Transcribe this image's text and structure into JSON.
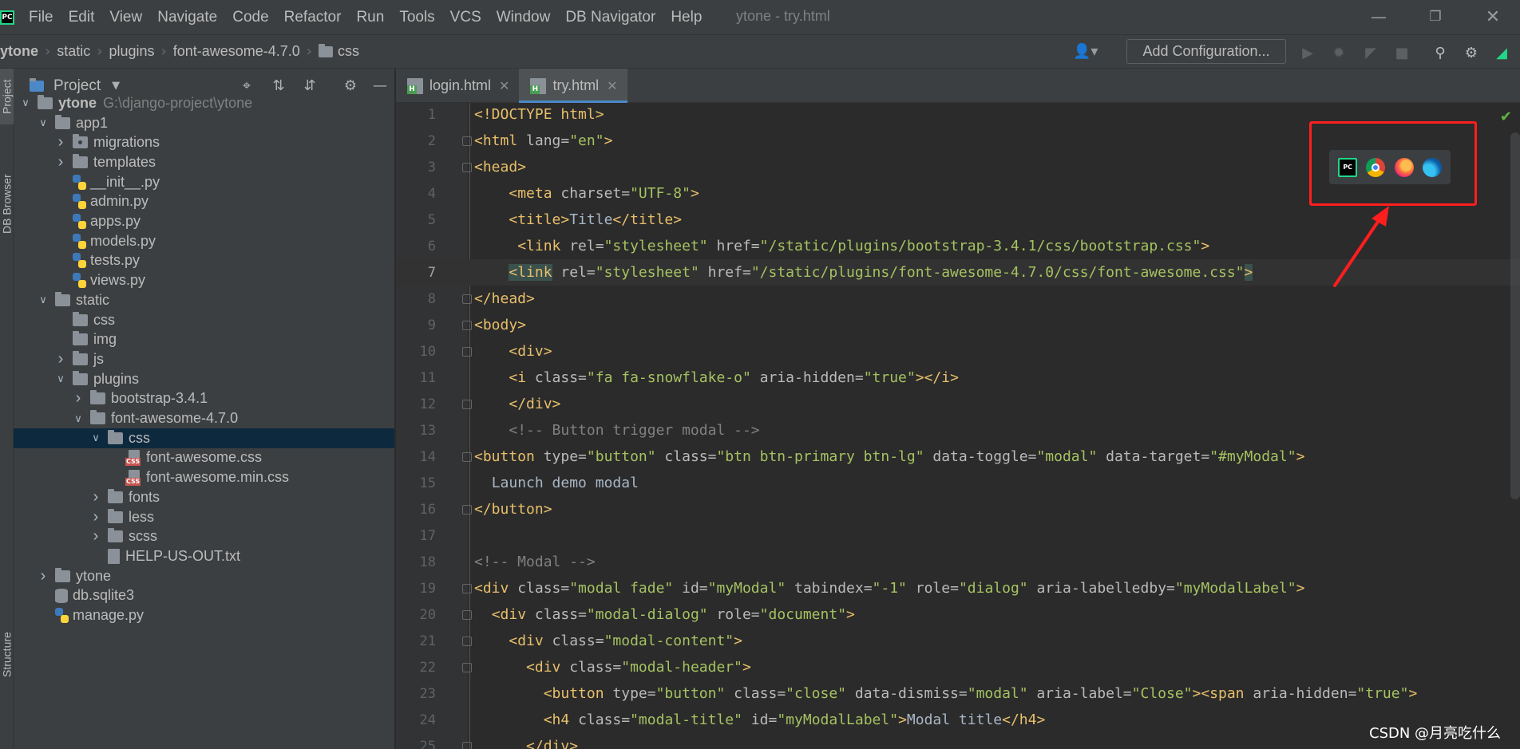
{
  "menubar": {
    "items": [
      "File",
      "Edit",
      "View",
      "Navigate",
      "Code",
      "Refactor",
      "Run",
      "Tools",
      "VCS",
      "Window",
      "DB Navigator",
      "Help"
    ],
    "window_title": "ytone - try.html"
  },
  "breadcrumb": [
    "ytone",
    "static",
    "plugins",
    "font-awesome-4.7.0",
    "css"
  ],
  "toolbar": {
    "add_configuration": "Add Configuration..."
  },
  "left_strip": {
    "project_tab": "Project",
    "db_browser_tab": "DB Browser",
    "structure_tab": "Structure"
  },
  "project_panel": {
    "title": "Project",
    "root_path": "G:\\django-project\\ytone",
    "tree": [
      {
        "label": "ytone",
        "type": "folder",
        "depth": 0,
        "expanded": true
      },
      {
        "label": "app1",
        "type": "folder",
        "depth": 1,
        "expanded": true
      },
      {
        "label": "migrations",
        "type": "package",
        "depth": 2,
        "expanded": false
      },
      {
        "label": "templates",
        "type": "folder",
        "depth": 2,
        "expanded": false
      },
      {
        "label": "__init__.py",
        "type": "py",
        "depth": 2
      },
      {
        "label": "admin.py",
        "type": "py",
        "depth": 2
      },
      {
        "label": "apps.py",
        "type": "py",
        "depth": 2
      },
      {
        "label": "models.py",
        "type": "py",
        "depth": 2
      },
      {
        "label": "tests.py",
        "type": "py",
        "depth": 2
      },
      {
        "label": "views.py",
        "type": "py",
        "depth": 2
      },
      {
        "label": "static",
        "type": "folder",
        "depth": 1,
        "expanded": true
      },
      {
        "label": "css",
        "type": "folder",
        "depth": 2
      },
      {
        "label": "img",
        "type": "folder",
        "depth": 2
      },
      {
        "label": "js",
        "type": "folder",
        "depth": 2,
        "expanded": false
      },
      {
        "label": "plugins",
        "type": "folder",
        "depth": 2,
        "expanded": true
      },
      {
        "label": "bootstrap-3.4.1",
        "type": "folder",
        "depth": 3,
        "expanded": false
      },
      {
        "label": "font-awesome-4.7.0",
        "type": "folder",
        "depth": 3,
        "expanded": true
      },
      {
        "label": "css",
        "type": "folder",
        "depth": 4,
        "expanded": true,
        "selected": true
      },
      {
        "label": "font-awesome.css",
        "type": "css",
        "depth": 5
      },
      {
        "label": "font-awesome.min.css",
        "type": "css",
        "depth": 5
      },
      {
        "label": "fonts",
        "type": "folder",
        "depth": 4,
        "expanded": false
      },
      {
        "label": "less",
        "type": "folder",
        "depth": 4,
        "expanded": false
      },
      {
        "label": "scss",
        "type": "folder",
        "depth": 4,
        "expanded": false
      },
      {
        "label": "HELP-US-OUT.txt",
        "type": "txt",
        "depth": 4
      },
      {
        "label": "ytone",
        "type": "folder",
        "depth": 1,
        "expanded": false
      },
      {
        "label": "db.sqlite3",
        "type": "db",
        "depth": 1
      },
      {
        "label": "manage.py",
        "type": "py",
        "depth": 1
      }
    ]
  },
  "editor": {
    "tabs": [
      {
        "label": "login.html",
        "active": false
      },
      {
        "label": "try.html",
        "active": true
      }
    ],
    "current_line": 7,
    "lines": [
      {
        "n": "1",
        "fold": false,
        "indent": "",
        "tokens": [
          [
            "tg",
            "<!DOCTYPE html>"
          ]
        ]
      },
      {
        "n": "2",
        "fold": true,
        "indent": "",
        "tokens": [
          [
            "tg",
            "<html "
          ],
          [
            "at",
            "lang="
          ],
          [
            "av",
            "\"en\""
          ],
          [
            "tg",
            ">"
          ]
        ]
      },
      {
        "n": "3",
        "fold": true,
        "indent": "",
        "tokens": [
          [
            "tg",
            "<head>"
          ]
        ]
      },
      {
        "n": "4",
        "fold": false,
        "indent": "    ",
        "tokens": [
          [
            "tg",
            "<meta "
          ],
          [
            "at",
            "charset="
          ],
          [
            "av",
            "\"UTF-8\""
          ],
          [
            "tg",
            ">"
          ]
        ]
      },
      {
        "n": "5",
        "fold": false,
        "indent": "    ",
        "tokens": [
          [
            "tg",
            "<title>"
          ],
          [
            "tx",
            "Title"
          ],
          [
            "tg",
            "</title>"
          ]
        ]
      },
      {
        "n": "6",
        "fold": false,
        "indent": "     ",
        "tokens": [
          [
            "tg",
            "<link "
          ],
          [
            "at",
            "rel="
          ],
          [
            "av",
            "\"stylesheet\""
          ],
          [
            "at",
            " href="
          ],
          [
            "av",
            "\"/static/plugins/bootstrap-3.4.1/css/bootstrap.css\""
          ],
          [
            "tg",
            ">"
          ]
        ]
      },
      {
        "n": "7",
        "fold": false,
        "indent": "    ",
        "tokens": [
          [
            "tg hl",
            "<link"
          ],
          [
            "at",
            " rel="
          ],
          [
            "av",
            "\"stylesheet\""
          ],
          [
            "at",
            " href="
          ],
          [
            "av",
            "\"/static/plugins/font-awesome-4.7.0/css/font-awesome.css\""
          ],
          [
            "tg hl",
            ">"
          ]
        ]
      },
      {
        "n": "8",
        "fold": true,
        "indent": "",
        "tokens": [
          [
            "tg",
            "</head>"
          ]
        ]
      },
      {
        "n": "9",
        "fold": true,
        "indent": "",
        "tokens": [
          [
            "tg",
            "<body>"
          ]
        ]
      },
      {
        "n": "10",
        "fold": true,
        "indent": "    ",
        "tokens": [
          [
            "tg",
            "<div>"
          ]
        ]
      },
      {
        "n": "11",
        "fold": false,
        "indent": "    ",
        "tokens": [
          [
            "tg",
            "<i "
          ],
          [
            "at",
            "class="
          ],
          [
            "av",
            "\"fa fa-snowflake-o\""
          ],
          [
            "at",
            " aria-hidden="
          ],
          [
            "av",
            "\"true\""
          ],
          [
            "tg",
            "></i>"
          ]
        ]
      },
      {
        "n": "12",
        "fold": true,
        "indent": "    ",
        "tokens": [
          [
            "tg",
            "</div>"
          ]
        ]
      },
      {
        "n": "13",
        "fold": false,
        "indent": "    ",
        "tokens": [
          [
            "cm",
            "<!-- Button trigger modal -->"
          ]
        ]
      },
      {
        "n": "14",
        "fold": true,
        "indent": "",
        "tokens": [
          [
            "tg",
            "<button "
          ],
          [
            "at",
            "type="
          ],
          [
            "av",
            "\"button\""
          ],
          [
            "at",
            " class="
          ],
          [
            "av",
            "\"btn btn-primary btn-lg\""
          ],
          [
            "at",
            " data-toggle="
          ],
          [
            "av",
            "\"modal\""
          ],
          [
            "at",
            " data-target="
          ],
          [
            "av",
            "\"#myModal\""
          ],
          [
            "tg",
            ">"
          ]
        ]
      },
      {
        "n": "15",
        "fold": false,
        "indent": "  ",
        "tokens": [
          [
            "tx",
            "Launch demo modal"
          ]
        ]
      },
      {
        "n": "16",
        "fold": true,
        "indent": "",
        "tokens": [
          [
            "tg",
            "</button>"
          ]
        ]
      },
      {
        "n": "17",
        "fold": false,
        "indent": "",
        "tokens": []
      },
      {
        "n": "18",
        "fold": false,
        "indent": "",
        "tokens": [
          [
            "cm",
            "<!-- Modal -->"
          ]
        ]
      },
      {
        "n": "19",
        "fold": true,
        "indent": "",
        "tokens": [
          [
            "tg",
            "<div "
          ],
          [
            "at",
            "class="
          ],
          [
            "av",
            "\"modal fade\""
          ],
          [
            "at",
            " id="
          ],
          [
            "av",
            "\"myModal\""
          ],
          [
            "at",
            " tabindex="
          ],
          [
            "av",
            "\"-1\""
          ],
          [
            "at",
            " role="
          ],
          [
            "av",
            "\"dialog\""
          ],
          [
            "at",
            " aria-labelledby="
          ],
          [
            "av",
            "\"myModalLabel\""
          ],
          [
            "tg",
            ">"
          ]
        ]
      },
      {
        "n": "20",
        "fold": true,
        "indent": "  ",
        "tokens": [
          [
            "tg",
            "<div "
          ],
          [
            "at",
            "class="
          ],
          [
            "av",
            "\"modal-dialog\""
          ],
          [
            "at",
            " role="
          ],
          [
            "av",
            "\"document\""
          ],
          [
            "tg",
            ">"
          ]
        ]
      },
      {
        "n": "21",
        "fold": true,
        "indent": "    ",
        "tokens": [
          [
            "tg",
            "<div "
          ],
          [
            "at",
            "class="
          ],
          [
            "av",
            "\"modal-content\""
          ],
          [
            "tg",
            ">"
          ]
        ]
      },
      {
        "n": "22",
        "fold": true,
        "indent": "      ",
        "tokens": [
          [
            "tg",
            "<div "
          ],
          [
            "at",
            "class="
          ],
          [
            "av",
            "\"modal-header\""
          ],
          [
            "tg",
            ">"
          ]
        ]
      },
      {
        "n": "23",
        "fold": false,
        "indent": "        ",
        "tokens": [
          [
            "tg",
            "<button "
          ],
          [
            "at",
            "type="
          ],
          [
            "av",
            "\"button\""
          ],
          [
            "at",
            " class="
          ],
          [
            "av",
            "\"close\""
          ],
          [
            "at",
            " data-dismiss="
          ],
          [
            "av",
            "\"modal\""
          ],
          [
            "at",
            " aria-label="
          ],
          [
            "av",
            "\"Close\""
          ],
          [
            "tg",
            "><span "
          ],
          [
            "at",
            "aria-hidden="
          ],
          [
            "av",
            "\"true\""
          ],
          [
            "tg",
            ">"
          ]
        ]
      },
      {
        "n": "24",
        "fold": false,
        "indent": "        ",
        "tokens": [
          [
            "tg",
            "<h4 "
          ],
          [
            "at",
            "class="
          ],
          [
            "av",
            "\"modal-title\""
          ],
          [
            "at",
            " id="
          ],
          [
            "av",
            "\"myModalLabel\""
          ],
          [
            "tg",
            ">"
          ],
          [
            "tx",
            "Modal title"
          ],
          [
            "tg",
            "</h4>"
          ]
        ]
      },
      {
        "n": "25",
        "fold": true,
        "indent": "      ",
        "tokens": [
          [
            "tg",
            "</div>"
          ]
        ]
      }
    ]
  },
  "browser_popup": {
    "icons": [
      "pycharm-icon",
      "chrome-icon",
      "firefox-icon",
      "edge-icon"
    ]
  },
  "annotation_color": "#ff1e1e",
  "watermark": "CSDN @月亮吃什么"
}
